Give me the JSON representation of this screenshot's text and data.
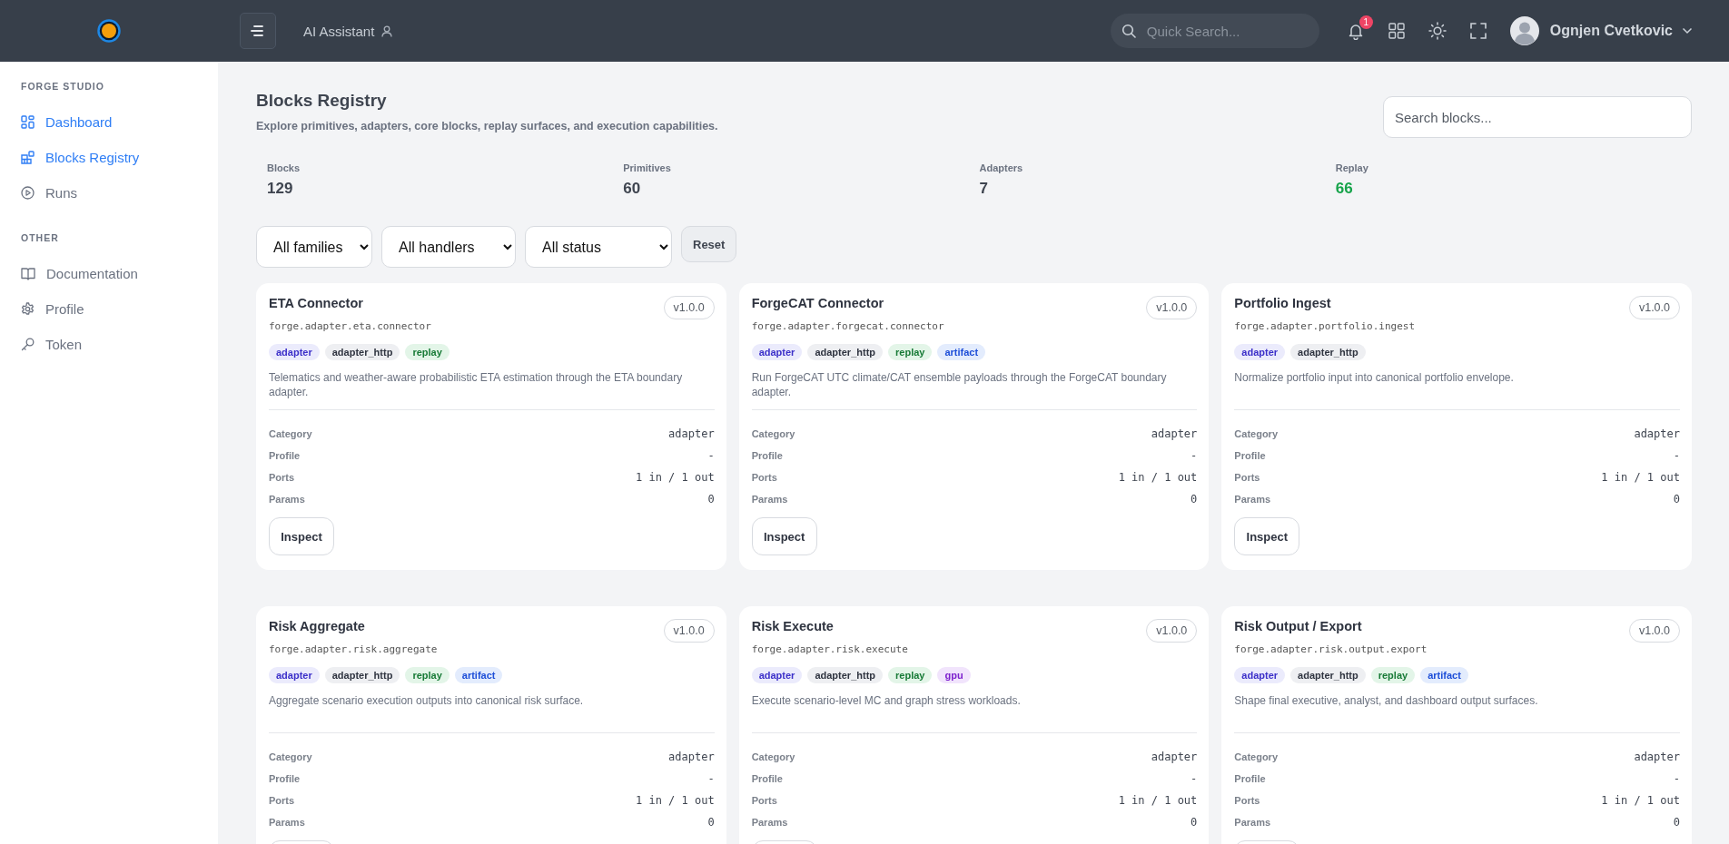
{
  "header": {
    "assistant_label": "AI Assistant",
    "search": {
      "placeholder": "Quick Search..."
    },
    "notifications": "1",
    "user_name": "Ognjen Cvetkovic"
  },
  "sidebar": {
    "sections": [
      {
        "title": "FORGE STUDIO",
        "items": [
          {
            "label": "Dashboard",
            "selected": true
          },
          {
            "label": "Blocks Registry",
            "selected": true
          },
          {
            "label": "Runs",
            "selected": false
          }
        ]
      },
      {
        "title": "OTHER",
        "items": [
          {
            "label": "Documentation",
            "selected": false
          },
          {
            "label": "Profile",
            "selected": false
          },
          {
            "label": "Token",
            "selected": false
          }
        ]
      }
    ]
  },
  "page": {
    "title": "Blocks Registry",
    "subtitle": "Explore primitives, adapters, core blocks, replay surfaces, and execution capabilities.",
    "search": {
      "placeholder": "Search blocks..."
    }
  },
  "stats": [
    {
      "label": "Blocks",
      "value": "129",
      "highlight": false
    },
    {
      "label": "Primitives",
      "value": "60",
      "highlight": false
    },
    {
      "label": "Adapters",
      "value": "7",
      "highlight": false
    },
    {
      "label": "Replay",
      "value": "66",
      "highlight": true
    }
  ],
  "filters": {
    "selects": [
      "All families",
      "All handlers",
      "All status"
    ],
    "reset": "Reset"
  },
  "cards": [
    {
      "title": "ETA Connector",
      "id": "forge.adapter.eta.connector",
      "version": "v1.0.0",
      "tags": [
        {
          "label": "adapter",
          "kind": "family"
        },
        {
          "label": "adapter_http",
          "kind": "handler"
        },
        {
          "label": "replay",
          "kind": "replay"
        }
      ],
      "description": "Telematics and weather-aware probabilistic ETA estimation through the ETA boundary adapter.",
      "fields": [
        {
          "label": "Category",
          "value": "adapter"
        },
        {
          "label": "Profile",
          "value": "-"
        },
        {
          "label": "Ports",
          "value": "1 in / 1 out"
        },
        {
          "label": "Params",
          "value": "0"
        }
      ],
      "button": "Inspect"
    },
    {
      "title": "ForgeCAT Connector",
      "id": "forge.adapter.forgecat.connector",
      "version": "v1.0.0",
      "tags": [
        {
          "label": "adapter",
          "kind": "family"
        },
        {
          "label": "adapter_http",
          "kind": "handler"
        },
        {
          "label": "replay",
          "kind": "replay"
        },
        {
          "label": "artifact",
          "kind": "artifact"
        }
      ],
      "description": "Run ForgeCAT UTC climate/CAT ensemble payloads through the ForgeCAT boundary adapter.",
      "fields": [
        {
          "label": "Category",
          "value": "adapter"
        },
        {
          "label": "Profile",
          "value": "-"
        },
        {
          "label": "Ports",
          "value": "1 in / 1 out"
        },
        {
          "label": "Params",
          "value": "0"
        }
      ],
      "button": "Inspect"
    },
    {
      "title": "Portfolio Ingest",
      "id": "forge.adapter.portfolio.ingest",
      "version": "v1.0.0",
      "tags": [
        {
          "label": "adapter",
          "kind": "family"
        },
        {
          "label": "adapter_http",
          "kind": "handler"
        }
      ],
      "description": "Normalize portfolio input into canonical portfolio envelope.",
      "fields": [
        {
          "label": "Category",
          "value": "adapter"
        },
        {
          "label": "Profile",
          "value": "-"
        },
        {
          "label": "Ports",
          "value": "1 in / 1 out"
        },
        {
          "label": "Params",
          "value": "0"
        }
      ],
      "button": "Inspect"
    },
    {
      "title": "Risk Aggregate",
      "id": "forge.adapter.risk.aggregate",
      "version": "v1.0.0",
      "tags": [
        {
          "label": "adapter",
          "kind": "family"
        },
        {
          "label": "adapter_http",
          "kind": "handler"
        },
        {
          "label": "replay",
          "kind": "replay"
        },
        {
          "label": "artifact",
          "kind": "artifact"
        }
      ],
      "description": "Aggregate scenario execution outputs into canonical risk surface.",
      "fields": [
        {
          "label": "Category",
          "value": "adapter"
        },
        {
          "label": "Profile",
          "value": "-"
        },
        {
          "label": "Ports",
          "value": "1 in / 1 out"
        },
        {
          "label": "Params",
          "value": "0"
        }
      ]
    },
    {
      "title": "Risk Execute",
      "id": "forge.adapter.risk.execute",
      "version": "v1.0.0",
      "tags": [
        {
          "label": "adapter",
          "kind": "family"
        },
        {
          "label": "adapter_http",
          "kind": "handler"
        },
        {
          "label": "replay",
          "kind": "replay"
        },
        {
          "label": "gpu",
          "kind": "gpu"
        }
      ],
      "description": "Execute scenario-level MC and graph stress workloads.",
      "fields": [
        {
          "label": "Category",
          "value": "adapter"
        },
        {
          "label": "Profile",
          "value": "-"
        },
        {
          "label": "Ports",
          "value": "1 in / 1 out"
        },
        {
          "label": "Params",
          "value": "0"
        }
      ]
    },
    {
      "title": "Risk Output / Export",
      "id": "forge.adapter.risk.output.export",
      "version": "v1.0.0",
      "tags": [
        {
          "label": "adapter",
          "kind": "family"
        },
        {
          "label": "adapter_http",
          "kind": "handler"
        },
        {
          "label": "replay",
          "kind": "replay"
        },
        {
          "label": "artifact",
          "kind": "artifact"
        }
      ],
      "description": "Shape final executive, analyst, and dashboard output surfaces.",
      "fields": [
        {
          "label": "Category",
          "value": "adapter"
        },
        {
          "label": "Profile",
          "value": "-"
        },
        {
          "label": "Ports",
          "value": "1 in / 1 out"
        },
        {
          "label": "Params",
          "value": "0"
        }
      ]
    }
  ]
}
